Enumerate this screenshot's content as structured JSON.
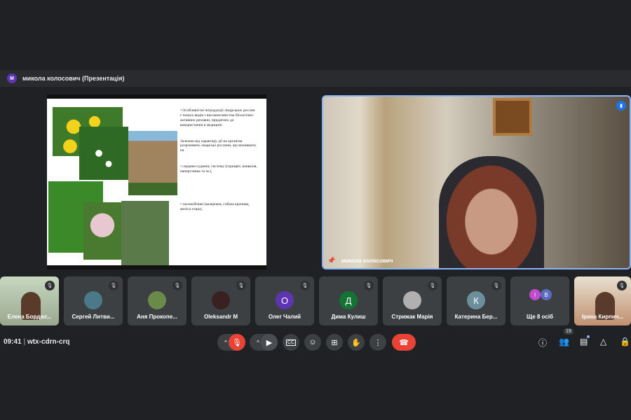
{
  "presenter_bar": {
    "avatar": "М",
    "title": "микола колосович (Презентація)"
  },
  "slide": {
    "paragraphs": [
      "• Особливістю інтродукції лікарських рослин є пошук видів з високим вмістом біологічно-активних речовин, придатних до використання в медицині.",
      "Залежно від характеру дії на організм розрізняють лікарські рослини, що впливають на",
      "• серцево-судинну систему (горицвіт, конвалія, наперстянка та ін.),",
      "• заспокійливі (валеріана, собача кропива, меліса тощо),"
    ]
  },
  "main_video": {
    "name": "микола колосович"
  },
  "participants": [
    {
      "name": "Елена Бордюг...",
      "type": "video"
    },
    {
      "name": "Сергей Литви...",
      "type": "photo",
      "color": "#4a7a8a"
    },
    {
      "name": "Аня Прокопе...",
      "type": "photo",
      "color": "#6a8a4a"
    },
    {
      "name": "Oleksandr M",
      "type": "photo",
      "color": "#3a2020"
    },
    {
      "name": "Олег Чалий",
      "initial": "О",
      "color": "#5e35b1"
    },
    {
      "name": "Дима Кулиш",
      "initial": "Д",
      "color": "#137333"
    },
    {
      "name": "Стрижак Марія",
      "type": "photo",
      "color": "#b0b0b0"
    },
    {
      "name": "Катерина Бер...",
      "initial": "К",
      "color": "#6d8f9b"
    },
    {
      "name": "Ще 8 осіб",
      "initials": [
        "І",
        "В"
      ]
    },
    {
      "name": "Ірина Кирпич...",
      "type": "video"
    }
  ],
  "footer": {
    "time": "09:41",
    "separator": "|",
    "meeting_code": "wtx-cdrn-crq",
    "people_count": "19"
  }
}
